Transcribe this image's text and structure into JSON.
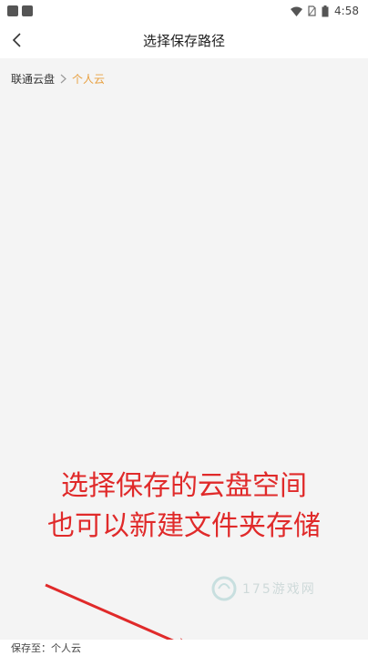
{
  "status": {
    "time": "4:58"
  },
  "header": {
    "title": "选择保存路径"
  },
  "breadcrumb": {
    "root": "联通云盘",
    "current": "个人云"
  },
  "annotation": {
    "line1": "选择保存的云盘空间",
    "line2": "也可以新建文件夹存储",
    "color": "#e02a2a"
  },
  "watermark": {
    "text": "175游戏网"
  },
  "footer": {
    "label": "保存至：",
    "value": "个人云"
  },
  "colors": {
    "accent": "#e8a040"
  }
}
